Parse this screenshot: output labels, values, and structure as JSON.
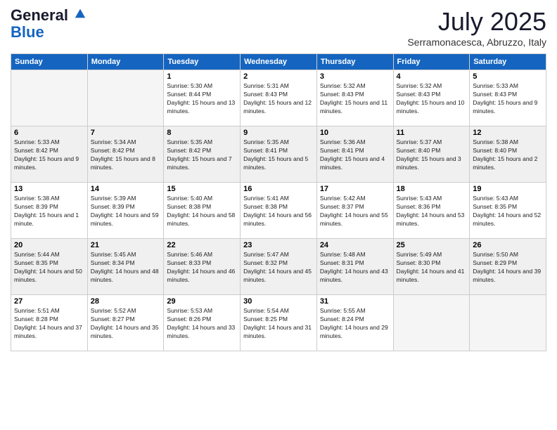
{
  "header": {
    "logo_line1": "General",
    "logo_line2": "Blue",
    "month": "July 2025",
    "location": "Serramonacesca, Abruzzo, Italy"
  },
  "days_of_week": [
    "Sunday",
    "Monday",
    "Tuesday",
    "Wednesday",
    "Thursday",
    "Friday",
    "Saturday"
  ],
  "weeks": [
    [
      {
        "day": "",
        "empty": true
      },
      {
        "day": "",
        "empty": true
      },
      {
        "day": "1",
        "sunrise": "5:30 AM",
        "sunset": "8:44 PM",
        "daylight": "15 hours and 13 minutes."
      },
      {
        "day": "2",
        "sunrise": "5:31 AM",
        "sunset": "8:43 PM",
        "daylight": "15 hours and 12 minutes."
      },
      {
        "day": "3",
        "sunrise": "5:32 AM",
        "sunset": "8:43 PM",
        "daylight": "15 hours and 11 minutes."
      },
      {
        "day": "4",
        "sunrise": "5:32 AM",
        "sunset": "8:43 PM",
        "daylight": "15 hours and 10 minutes."
      },
      {
        "day": "5",
        "sunrise": "5:33 AM",
        "sunset": "8:43 PM",
        "daylight": "15 hours and 9 minutes."
      }
    ],
    [
      {
        "day": "6",
        "sunrise": "5:33 AM",
        "sunset": "8:42 PM",
        "daylight": "15 hours and 9 minutes."
      },
      {
        "day": "7",
        "sunrise": "5:34 AM",
        "sunset": "8:42 PM",
        "daylight": "15 hours and 8 minutes."
      },
      {
        "day": "8",
        "sunrise": "5:35 AM",
        "sunset": "8:42 PM",
        "daylight": "15 hours and 7 minutes."
      },
      {
        "day": "9",
        "sunrise": "5:35 AM",
        "sunset": "8:41 PM",
        "daylight": "15 hours and 5 minutes."
      },
      {
        "day": "10",
        "sunrise": "5:36 AM",
        "sunset": "8:41 PM",
        "daylight": "15 hours and 4 minutes."
      },
      {
        "day": "11",
        "sunrise": "5:37 AM",
        "sunset": "8:40 PM",
        "daylight": "15 hours and 3 minutes."
      },
      {
        "day": "12",
        "sunrise": "5:38 AM",
        "sunset": "8:40 PM",
        "daylight": "15 hours and 2 minutes."
      }
    ],
    [
      {
        "day": "13",
        "sunrise": "5:38 AM",
        "sunset": "8:39 PM",
        "daylight": "15 hours and 1 minute."
      },
      {
        "day": "14",
        "sunrise": "5:39 AM",
        "sunset": "8:39 PM",
        "daylight": "14 hours and 59 minutes."
      },
      {
        "day": "15",
        "sunrise": "5:40 AM",
        "sunset": "8:38 PM",
        "daylight": "14 hours and 58 minutes."
      },
      {
        "day": "16",
        "sunrise": "5:41 AM",
        "sunset": "8:38 PM",
        "daylight": "14 hours and 56 minutes."
      },
      {
        "day": "17",
        "sunrise": "5:42 AM",
        "sunset": "8:37 PM",
        "daylight": "14 hours and 55 minutes."
      },
      {
        "day": "18",
        "sunrise": "5:43 AM",
        "sunset": "8:36 PM",
        "daylight": "14 hours and 53 minutes."
      },
      {
        "day": "19",
        "sunrise": "5:43 AM",
        "sunset": "8:35 PM",
        "daylight": "14 hours and 52 minutes."
      }
    ],
    [
      {
        "day": "20",
        "sunrise": "5:44 AM",
        "sunset": "8:35 PM",
        "daylight": "14 hours and 50 minutes."
      },
      {
        "day": "21",
        "sunrise": "5:45 AM",
        "sunset": "8:34 PM",
        "daylight": "14 hours and 48 minutes."
      },
      {
        "day": "22",
        "sunrise": "5:46 AM",
        "sunset": "8:33 PM",
        "daylight": "14 hours and 46 minutes."
      },
      {
        "day": "23",
        "sunrise": "5:47 AM",
        "sunset": "8:32 PM",
        "daylight": "14 hours and 45 minutes."
      },
      {
        "day": "24",
        "sunrise": "5:48 AM",
        "sunset": "8:31 PM",
        "daylight": "14 hours and 43 minutes."
      },
      {
        "day": "25",
        "sunrise": "5:49 AM",
        "sunset": "8:30 PM",
        "daylight": "14 hours and 41 minutes."
      },
      {
        "day": "26",
        "sunrise": "5:50 AM",
        "sunset": "8:29 PM",
        "daylight": "14 hours and 39 minutes."
      }
    ],
    [
      {
        "day": "27",
        "sunrise": "5:51 AM",
        "sunset": "8:28 PM",
        "daylight": "14 hours and 37 minutes."
      },
      {
        "day": "28",
        "sunrise": "5:52 AM",
        "sunset": "8:27 PM",
        "daylight": "14 hours and 35 minutes."
      },
      {
        "day": "29",
        "sunrise": "5:53 AM",
        "sunset": "8:26 PM",
        "daylight": "14 hours and 33 minutes."
      },
      {
        "day": "30",
        "sunrise": "5:54 AM",
        "sunset": "8:25 PM",
        "daylight": "14 hours and 31 minutes."
      },
      {
        "day": "31",
        "sunrise": "5:55 AM",
        "sunset": "8:24 PM",
        "daylight": "14 hours and 29 minutes."
      },
      {
        "day": "",
        "empty": true
      },
      {
        "day": "",
        "empty": true
      }
    ]
  ]
}
